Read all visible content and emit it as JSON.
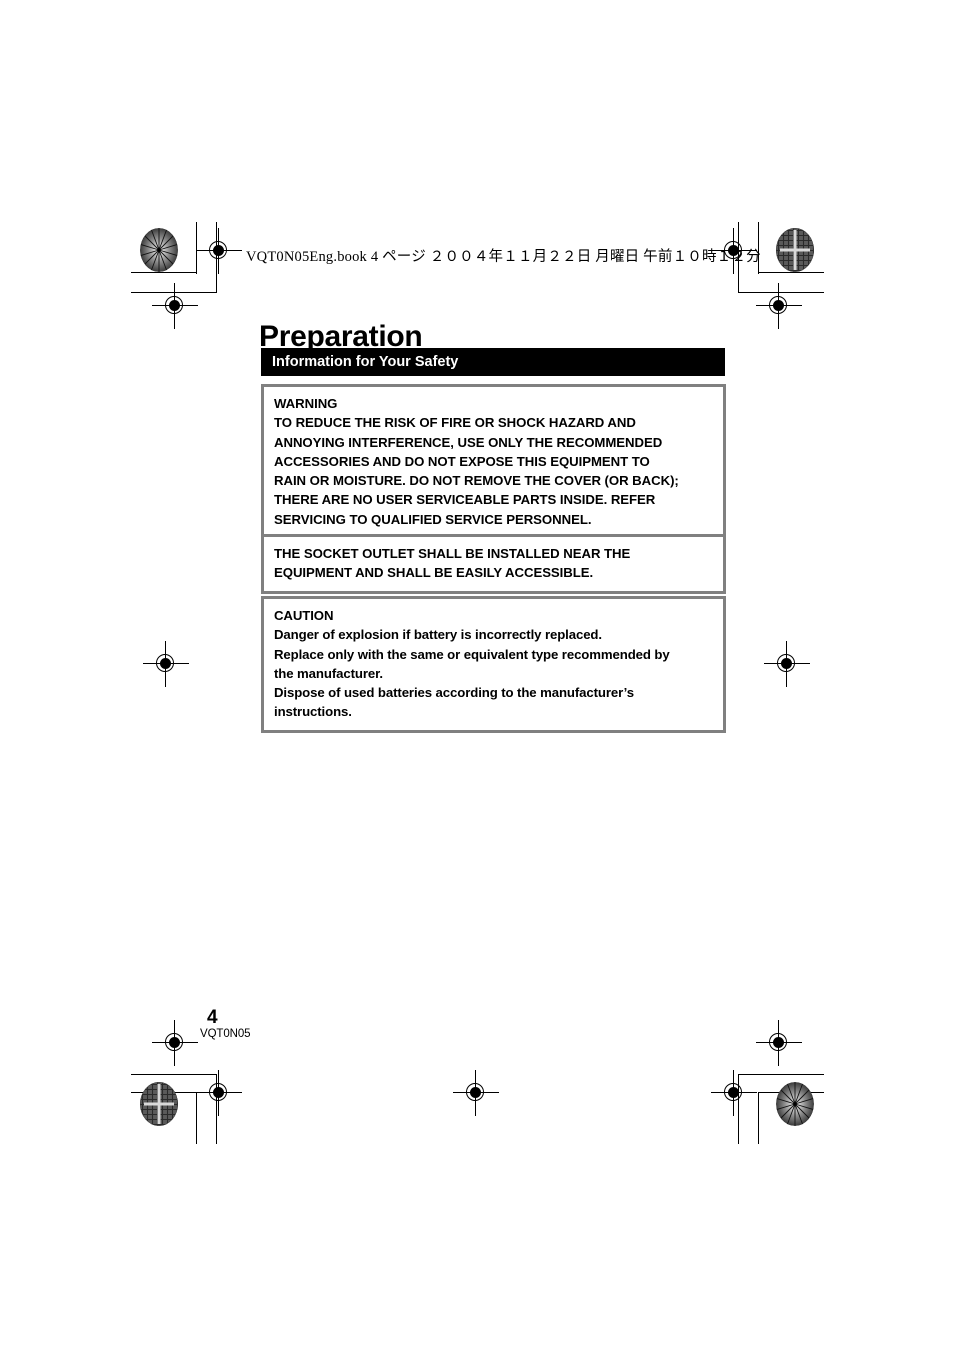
{
  "document": {
    "filename_header": "VQT0N05Eng.book   4 ページ   ２００４年１１月２２日   月曜日   午前１０時１２分",
    "page_title": "Preparation",
    "section_heading": "Information for Your Safety",
    "page_number": "4",
    "model_code": "VQT0N05",
    "colors": {
      "section_bar_background": "#000000",
      "section_bar_text": "#ffffff",
      "box_border": "#808080",
      "page_background": "#ffffff",
      "body_text": "#000000"
    }
  },
  "notices": [
    {
      "id": "warning",
      "heading": "WARNING",
      "lines": [
        "TO REDUCE THE RISK OF FIRE OR SHOCK HAZARD AND",
        "ANNOYING INTERFERENCE, USE ONLY THE RECOMMENDED",
        "ACCESSORIES AND DO NOT EXPOSE THIS EQUIPMENT TO",
        "RAIN OR MOISTURE. DO NOT REMOVE THE COVER (OR BACK);",
        "THERE ARE NO USER SERVICEABLE PARTS INSIDE. REFER",
        "SERVICING TO QUALIFIED SERVICE PERSONNEL."
      ]
    },
    {
      "id": "socket",
      "heading": "",
      "lines": [
        "THE SOCKET OUTLET SHALL BE INSTALLED NEAR THE",
        "EQUIPMENT AND SHALL BE EASILY ACCESSIBLE."
      ]
    },
    {
      "id": "caution",
      "heading": "CAUTION",
      "lines": [
        "Danger of explosion if battery is incorrectly replaced.",
        "Replace only with the same or equivalent type recommended by",
        "the manufacturer.",
        "Dispose of used batteries according to the manufacturer’s",
        "instructions."
      ]
    }
  ],
  "print_marks": {
    "registration_target_icon": "registration-crosshair-icon",
    "halftone_target_icon": "halftone-density-target-icon",
    "crop_mark_icon": "crop-mark-icon"
  },
  "warning_box": {
    "heading": "WARNING",
    "line_1": "TO REDUCE THE RISK OF FIRE OR SHOCK HAZARD AND",
    "line_2": "ANNOYING INTERFERENCE, USE ONLY THE RECOMMENDED",
    "line_3": "ACCESSORIES AND DO NOT EXPOSE THIS EQUIPMENT TO",
    "line_4": "RAIN OR MOISTURE. DO NOT REMOVE THE COVER (OR BACK);",
    "line_5": "THERE ARE NO USER SERVICEABLE PARTS INSIDE. REFER",
    "line_6": "SERVICING TO QUALIFIED SERVICE PERSONNEL."
  },
  "socket_box": {
    "line_1": "THE SOCKET OUTLET SHALL BE INSTALLED NEAR THE",
    "line_2": "EQUIPMENT AND SHALL BE EASILY ACCESSIBLE."
  },
  "caution_box": {
    "heading": "CAUTION",
    "line_1": "Danger of explosion if battery is incorrectly replaced.",
    "line_2": "Replace only with the same or equivalent type recommended by",
    "line_3": "the manufacturer.",
    "line_4": "Dispose of used batteries according to the manufacturer’s",
    "line_5": "instructions."
  }
}
